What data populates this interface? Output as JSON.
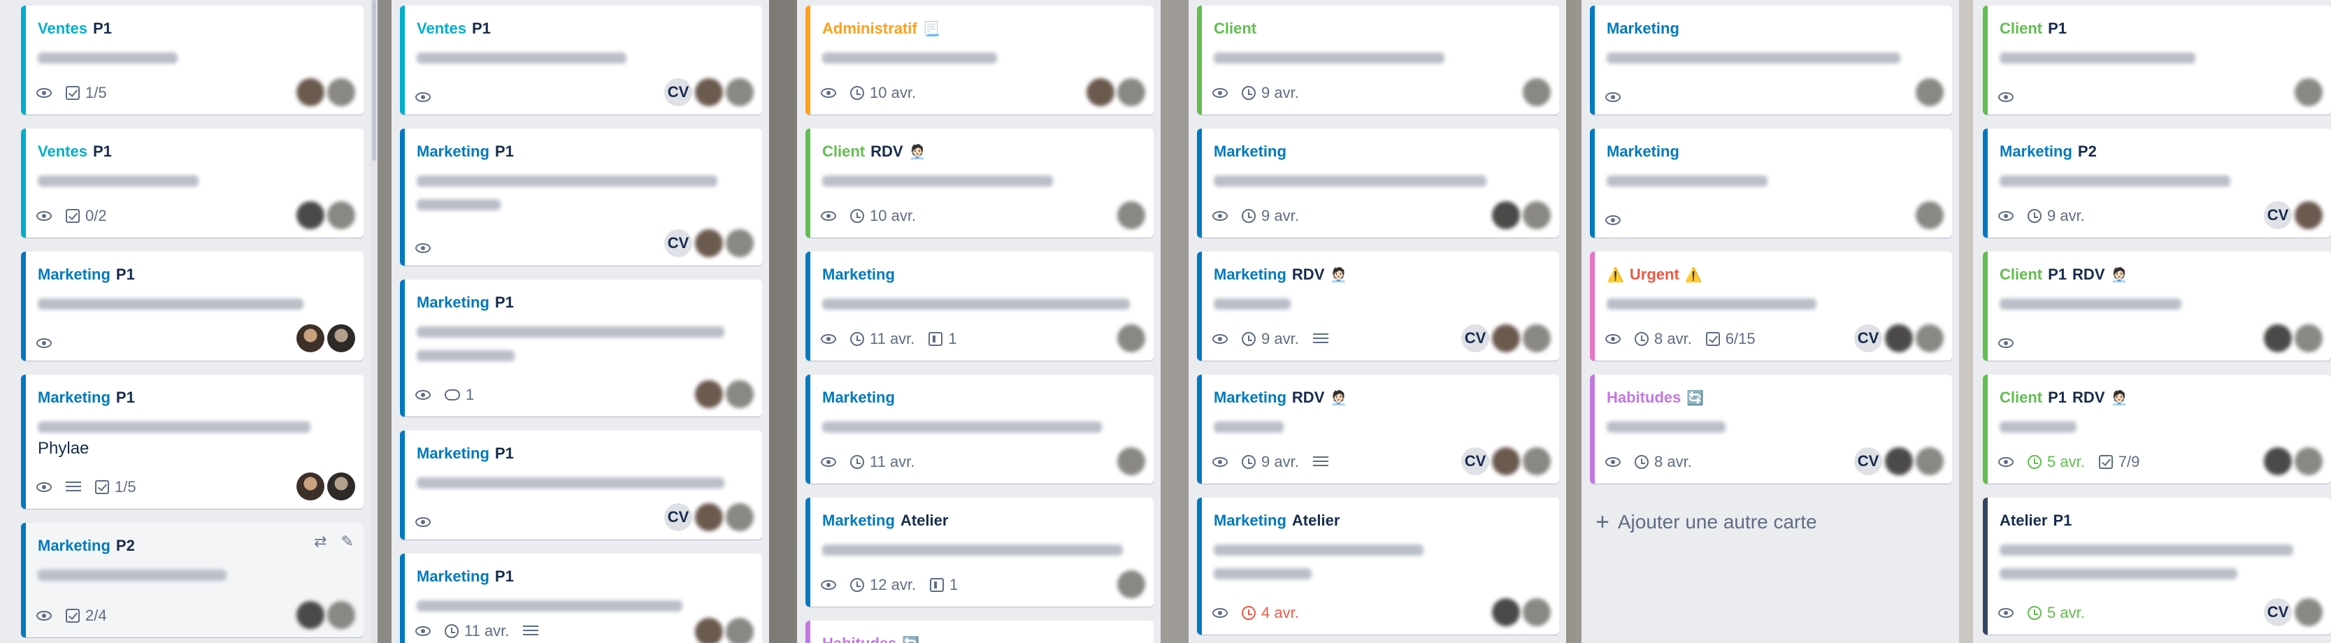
{
  "columns": [
    {
      "cards": [
        {
          "labels": [
            "Ventes",
            "P1"
          ],
          "badges": {
            "checklist": "1/5"
          },
          "members": [
            "blur",
            "blur"
          ]
        },
        {
          "labels": [
            "Ventes",
            "P1"
          ],
          "badges": {
            "checklist": "0/2"
          },
          "members": [
            "blur",
            "blur"
          ]
        },
        {
          "labels": [
            "Marketing",
            "P1"
          ],
          "members": [
            "photo",
            "photo"
          ]
        },
        {
          "labels": [
            "Marketing",
            "P1"
          ],
          "title_tail": "Phylae",
          "badges": {
            "checklist": "1/5"
          },
          "members": [
            "photo",
            "photo"
          ]
        },
        {
          "labels": [
            "Marketing",
            "P2"
          ],
          "badges": {
            "checklist": "2/4"
          },
          "members": [
            "blur",
            "blur"
          ]
        }
      ]
    },
    {
      "cards": [
        {
          "labels": [
            "Ventes",
            "P1"
          ],
          "members": [
            "CV",
            "blur",
            "blur"
          ]
        },
        {
          "labels": [
            "Marketing",
            "P1"
          ],
          "members": [
            "CV",
            "blur",
            "blur"
          ]
        },
        {
          "labels": [
            "Marketing",
            "P1"
          ],
          "badges": {
            "comments": "1"
          },
          "members": [
            "blur",
            "blur"
          ]
        },
        {
          "labels": [
            "Marketing",
            "P1"
          ],
          "members": [
            "CV",
            "blur",
            "blur"
          ]
        },
        {
          "labels": [
            "Marketing",
            "P1"
          ],
          "badges": {
            "due": "11 avr."
          },
          "members": [
            "blur",
            "blur"
          ]
        }
      ]
    },
    {
      "cards": [
        {
          "labels": [
            "Administratif",
            "📃"
          ],
          "badges": {
            "due": "10 avr."
          },
          "members": [
            "blur",
            "blur"
          ]
        },
        {
          "labels": [
            "Client",
            "RDV",
            "🧑🏻‍💼"
          ],
          "badges": {
            "due": "10 avr."
          },
          "members": [
            "blur"
          ]
        },
        {
          "labels": [
            "Marketing"
          ],
          "badges": {
            "due": "11 avr.",
            "attachments": "1"
          },
          "members": [
            "blur"
          ]
        },
        {
          "labels": [
            "Marketing"
          ],
          "badges": {
            "due": "11 avr."
          },
          "members": [
            "blur"
          ]
        },
        {
          "labels": [
            "Marketing",
            "Atelier"
          ],
          "badges": {
            "due": "12 avr.",
            "attachments": "1"
          },
          "members": [
            "blur"
          ]
        },
        {
          "labels": [
            "Habitudes",
            "🔄"
          ]
        }
      ]
    },
    {
      "cards": [
        {
          "labels": [
            "Client"
          ],
          "badges": {
            "due": "9 avr."
          },
          "members": [
            "blur"
          ]
        },
        {
          "labels": [
            "Marketing"
          ],
          "badges": {
            "due": "9 avr."
          },
          "members": [
            "blur",
            "blur"
          ]
        },
        {
          "labels": [
            "Marketing",
            "RDV",
            "🧑🏻‍💼"
          ],
          "badges": {
            "due": "9 avr."
          },
          "members": [
            "CV",
            "blur",
            "blur"
          ]
        },
        {
          "labels": [
            "Marketing",
            "RDV",
            "🧑🏻‍💼"
          ],
          "badges": {
            "due": "9 avr."
          },
          "members": [
            "CV",
            "blur",
            "blur"
          ]
        },
        {
          "labels": [
            "Marketing",
            "Atelier"
          ],
          "badges": {
            "due": "4 avr."
          },
          "members": [
            "blur",
            "blur"
          ]
        }
      ]
    },
    {
      "cards": [
        {
          "labels": [
            "Marketing"
          ],
          "members": [
            "blur"
          ]
        },
        {
          "labels": [
            "Marketing"
          ],
          "members": [
            "blur"
          ]
        },
        {
          "labels": [
            "⚠️",
            "Urgent",
            "⚠️"
          ],
          "badges": {
            "due": "8 avr.",
            "checklist": "6/15"
          },
          "members": [
            "CV",
            "blur",
            "blur"
          ]
        },
        {
          "labels": [
            "Habitudes",
            "🔄"
          ],
          "badges": {
            "due": "8 avr."
          },
          "members": [
            "CV",
            "blur",
            "blur"
          ]
        }
      ],
      "add_card": "Ajouter une autre carte"
    },
    {
      "cards": [
        {
          "labels": [
            "Client",
            "P1"
          ],
          "members": [
            "blur"
          ]
        },
        {
          "labels": [
            "Marketing",
            "P2"
          ],
          "badges": {
            "due": "9 avr."
          },
          "members": [
            "CV",
            "blur"
          ]
        },
        {
          "labels": [
            "Client",
            "P1",
            "RDV",
            "🧑🏻‍💼"
          ],
          "members": [
            "blur",
            "blur"
          ]
        },
        {
          "labels": [
            "Client",
            "P1",
            "RDV",
            "🧑🏻‍💼"
          ],
          "badges": {
            "due": "5 avr.",
            "checklist": "7/9"
          },
          "members": [
            "blur",
            "blur"
          ]
        },
        {
          "labels": [
            "Atelier",
            "P1"
          ],
          "badges": {
            "due": "5 avr."
          },
          "members": [
            "CV",
            "blur"
          ]
        }
      ]
    }
  ],
  "member_initials": "CV",
  "colors": {
    "ventes": "#00aecc",
    "marketing": "#0079bf",
    "client": "#61bd4f",
    "administratif": "#ff9f1a",
    "urgent": "#eb5a46",
    "habitudes": "#c377e0",
    "atelier": "#344563",
    "list_bg": "#ebecf0"
  },
  "icons": [
    "eye-icon",
    "clock-icon",
    "checklist-icon",
    "description-icon",
    "attachment-icon",
    "comment-icon",
    "swap-icon",
    "pencil-icon",
    "plus-icon"
  ]
}
